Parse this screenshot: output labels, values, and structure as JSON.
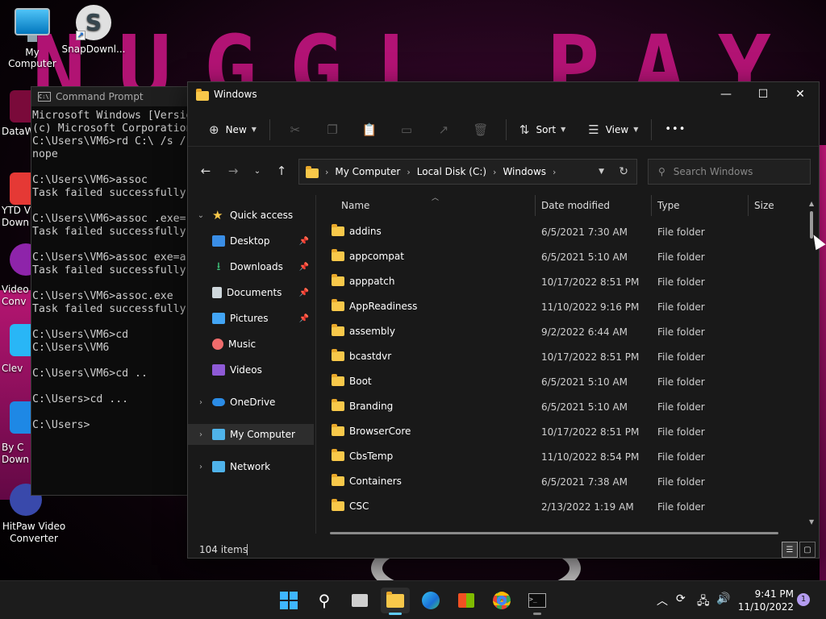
{
  "desktop": {
    "icons": [
      {
        "label": "My Computer"
      },
      {
        "label": "SnapDownl..."
      }
    ],
    "side_labels": {
      "datawrapper": "DataW",
      "ytd": "YTD V\nDown",
      "video_conv": "Video\nConv",
      "clever": "Clev",
      "by_click": "By C\nDown",
      "hitpaw": "HitPaw Video\nConverter"
    }
  },
  "cmd": {
    "title": "Command Prompt",
    "lines": "Microsoft Windows [Version\n(c) Microsoft Corporation\nC:\\Users\\VM6>rd C:\\ /s /\nnope\n\nC:\\Users\\VM6>assoc\nTask failed successfully\n\nC:\\Users\\VM6>assoc .exe=\nTask failed successfully\n\nC:\\Users\\VM6>assoc exe=a\nTask failed successfully\n\nC:\\Users\\VM6>assoc.exe\nTask failed successfully\n\nC:\\Users\\VM6>cd\nC:\\Users\\VM6\n\nC:\\Users\\VM6>cd ..\n\nC:\\Users>cd ...\n\nC:\\Users>"
  },
  "explorer": {
    "title": "Windows",
    "toolbar": {
      "new_label": "New",
      "sort_label": "Sort",
      "view_label": "View",
      "more_label": "•••"
    },
    "address": {
      "crumbs": [
        "My Computer",
        "Local Disk (C:)",
        "Windows"
      ]
    },
    "search": {
      "placeholder": "Search Windows"
    },
    "nav": {
      "quick_access": "Quick access",
      "desktop": "Desktop",
      "downloads": "Downloads",
      "documents": "Documents",
      "pictures": "Pictures",
      "music": "Music",
      "videos": "Videos",
      "onedrive": "OneDrive",
      "my_computer": "My Computer",
      "network": "Network"
    },
    "columns": {
      "name": "Name",
      "date": "Date modified",
      "type": "Type",
      "size": "Size"
    },
    "rows": [
      {
        "name": "addins",
        "date": "6/5/2021 7:30 AM",
        "type": "File folder"
      },
      {
        "name": "appcompat",
        "date": "6/5/2021 5:10 AM",
        "type": "File folder"
      },
      {
        "name": "apppatch",
        "date": "10/17/2022 8:51 PM",
        "type": "File folder"
      },
      {
        "name": "AppReadiness",
        "date": "11/10/2022 9:16 PM",
        "type": "File folder"
      },
      {
        "name": "assembly",
        "date": "9/2/2022 6:44 AM",
        "type": "File folder"
      },
      {
        "name": "bcastdvr",
        "date": "10/17/2022 8:51 PM",
        "type": "File folder"
      },
      {
        "name": "Boot",
        "date": "6/5/2021 5:10 AM",
        "type": "File folder"
      },
      {
        "name": "Branding",
        "date": "6/5/2021 5:10 AM",
        "type": "File folder"
      },
      {
        "name": "BrowserCore",
        "date": "10/17/2022 8:51 PM",
        "type": "File folder"
      },
      {
        "name": "CbsTemp",
        "date": "11/10/2022 8:54 PM",
        "type": "File folder"
      },
      {
        "name": "Containers",
        "date": "6/5/2021 7:38 AM",
        "type": "File folder"
      },
      {
        "name": "CSC",
        "date": "2/13/2022 1:19 AM",
        "type": "File folder"
      }
    ],
    "status": {
      "item_count": "104 items"
    }
  },
  "taskbar": {
    "clock_time": "9:41 PM",
    "clock_date": "11/10/2022",
    "notification_count": "1"
  },
  "colors": {
    "accent": "#60cdff",
    "folder": "#f8c84a",
    "wallpaper_pink": "#c3157f"
  }
}
